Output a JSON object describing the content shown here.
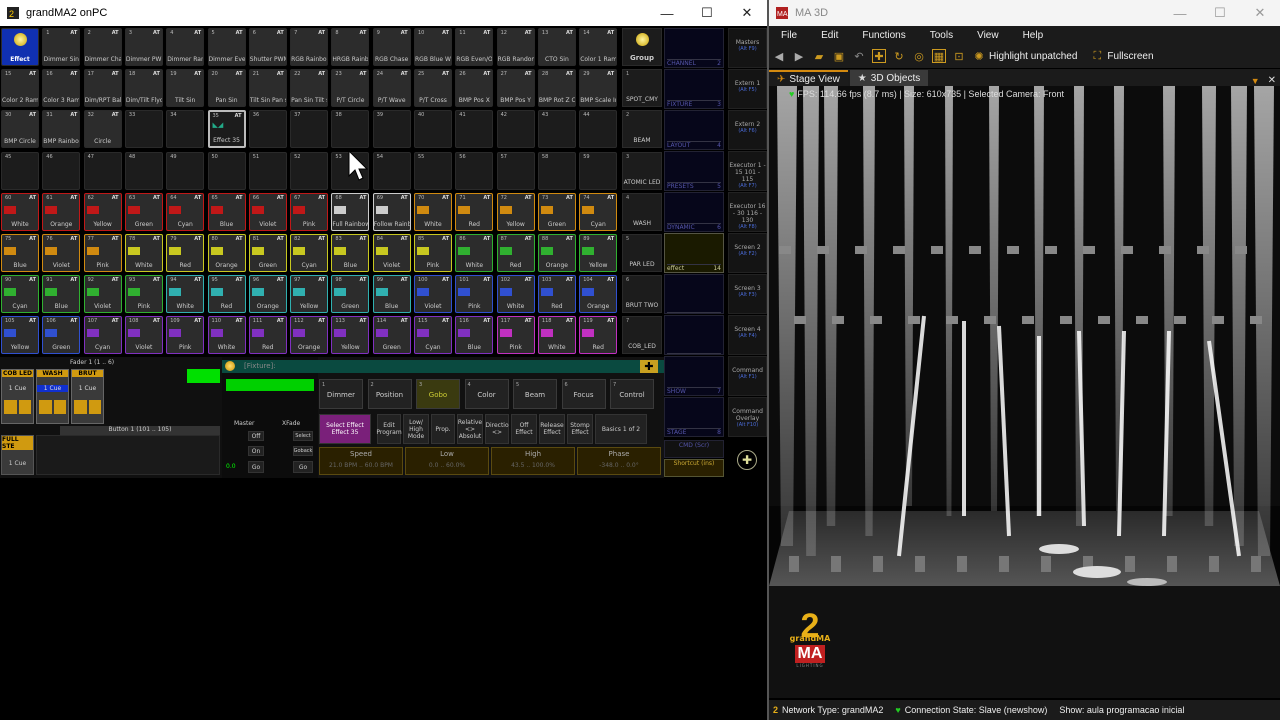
{
  "left_window": {
    "title": "grandMA2 onPC",
    "controls": {
      "minimize": "—",
      "maximize": "☐",
      "close": "✕"
    }
  },
  "grid_rows": [
    [
      {
        "n": "",
        "label": "Effect",
        "kind": "effect"
      },
      {
        "n": "1",
        "label": "Dimmer Sin"
      },
      {
        "n": "2",
        "label": "Dimmer Chase"
      },
      {
        "n": "3",
        "label": "Dimmer PWM"
      },
      {
        "n": "4",
        "label": "Dimmer Random"
      },
      {
        "n": "5",
        "label": "Dimmer Even/Odd"
      },
      {
        "n": "6",
        "label": "Shutter PWM"
      },
      {
        "n": "7",
        "label": "RGB Rainbow"
      },
      {
        "n": "8",
        "label": "HRGB Rainbow"
      },
      {
        "n": "9",
        "label": "RGB Chase"
      },
      {
        "n": "10",
        "label": "RGB Blue White"
      },
      {
        "n": "11",
        "label": "RGB Even/Odd"
      },
      {
        "n": "12",
        "label": "RGB Random"
      },
      {
        "n": "13",
        "label": "CTO Sin"
      },
      {
        "n": "14",
        "label": "Color 1 Ramp"
      }
    ],
    [
      {
        "n": "15",
        "label": "Color 2 Ramp"
      },
      {
        "n": "16",
        "label": "Color 3 Ramp"
      },
      {
        "n": "17",
        "label": "Dim/RPT Ballyhoo"
      },
      {
        "n": "18",
        "label": "Dim/Tilt Flyout"
      },
      {
        "n": "19",
        "label": "Tilt Sin"
      },
      {
        "n": "20",
        "label": "Pan Sin"
      },
      {
        "n": "21",
        "label": "Tilt Sin Pan stomp"
      },
      {
        "n": "22",
        "label": "Pan Sin Tilt stomp"
      },
      {
        "n": "23",
        "label": "P/T Circle"
      },
      {
        "n": "24",
        "label": "P/T Wave"
      },
      {
        "n": "25",
        "label": "P/T Cross"
      },
      {
        "n": "26",
        "label": "BMP Pos X"
      },
      {
        "n": "27",
        "label": "BMP Pos Y"
      },
      {
        "n": "28",
        "label": "BMP Rot Z CW"
      },
      {
        "n": "29",
        "label": "BMP Scale In"
      }
    ],
    [
      {
        "n": "30",
        "label": "BMP Circle"
      },
      {
        "n": "31",
        "label": "BMP Rainbow Hue"
      },
      {
        "n": "32",
        "label": "Circle"
      },
      {
        "n": "33",
        "label": ""
      },
      {
        "n": "34",
        "label": ""
      },
      {
        "n": "35",
        "label": "Effect 35",
        "kind": "sel"
      },
      {
        "n": "36",
        "label": ""
      },
      {
        "n": "37",
        "label": ""
      },
      {
        "n": "38",
        "label": ""
      },
      {
        "n": "39",
        "label": ""
      },
      {
        "n": "40",
        "label": ""
      },
      {
        "n": "41",
        "label": ""
      },
      {
        "n": "42",
        "label": ""
      },
      {
        "n": "43",
        "label": ""
      },
      {
        "n": "44",
        "label": ""
      }
    ],
    [
      {
        "n": "45",
        "label": ""
      },
      {
        "n": "46",
        "label": ""
      },
      {
        "n": "47",
        "label": ""
      },
      {
        "n": "48",
        "label": ""
      },
      {
        "n": "49",
        "label": ""
      },
      {
        "n": "50",
        "label": ""
      },
      {
        "n": "51",
        "label": ""
      },
      {
        "n": "52",
        "label": ""
      },
      {
        "n": "53",
        "label": ""
      },
      {
        "n": "54",
        "label": ""
      },
      {
        "n": "55",
        "label": ""
      },
      {
        "n": "56",
        "label": ""
      },
      {
        "n": "57",
        "label": ""
      },
      {
        "n": "58",
        "label": ""
      },
      {
        "n": "59",
        "label": ""
      }
    ],
    [
      {
        "n": "60",
        "label": "White",
        "c": "#c01818"
      },
      {
        "n": "61",
        "label": "Orange",
        "c": "#c01818"
      },
      {
        "n": "62",
        "label": "Yellow",
        "c": "#c01818"
      },
      {
        "n": "63",
        "label": "Green",
        "c": "#c01818"
      },
      {
        "n": "64",
        "label": "Cyan",
        "c": "#c01818"
      },
      {
        "n": "65",
        "label": "Blue",
        "c": "#c01818"
      },
      {
        "n": "66",
        "label": "Violet",
        "c": "#c01818"
      },
      {
        "n": "67",
        "label": "Pink",
        "c": "#c01818"
      },
      {
        "n": "68",
        "label": "Full Rainbow",
        "c": "#cccccc"
      },
      {
        "n": "69",
        "label": "Follow Rainbow",
        "c": "#cccccc"
      },
      {
        "n": "70",
        "label": "White",
        "c": "#d08a10"
      },
      {
        "n": "71",
        "label": "Red",
        "c": "#d08a10"
      },
      {
        "n": "72",
        "label": "Yellow",
        "c": "#d08a10"
      },
      {
        "n": "73",
        "label": "Green",
        "c": "#d08a10"
      },
      {
        "n": "74",
        "label": "Cyan",
        "c": "#d08a10"
      }
    ],
    [
      {
        "n": "75",
        "label": "Blue",
        "c": "#d08a10"
      },
      {
        "n": "76",
        "label": "Violet",
        "c": "#d08a10"
      },
      {
        "n": "77",
        "label": "Pink",
        "c": "#d08a10"
      },
      {
        "n": "78",
        "label": "White",
        "c": "#c8c820"
      },
      {
        "n": "79",
        "label": "Red",
        "c": "#c8c820"
      },
      {
        "n": "80",
        "label": "Orange",
        "c": "#c8c820"
      },
      {
        "n": "81",
        "label": "Green",
        "c": "#c8c820"
      },
      {
        "n": "82",
        "label": "Cyan",
        "c": "#c8c820"
      },
      {
        "n": "83",
        "label": "Blue",
        "c": "#c8c820"
      },
      {
        "n": "84",
        "label": "Violet",
        "c": "#c8c820"
      },
      {
        "n": "85",
        "label": "Pink",
        "c": "#c8c820"
      },
      {
        "n": "86",
        "label": "White",
        "c": "#30b030"
      },
      {
        "n": "87",
        "label": "Red",
        "c": "#30b030"
      },
      {
        "n": "88",
        "label": "Orange",
        "c": "#30b030"
      },
      {
        "n": "89",
        "label": "Yellow",
        "c": "#30b030"
      }
    ],
    [
      {
        "n": "90",
        "label": "Cyan",
        "c": "#30b030"
      },
      {
        "n": "91",
        "label": "Blue",
        "c": "#30b030"
      },
      {
        "n": "92",
        "label": "Violet",
        "c": "#30b030"
      },
      {
        "n": "93",
        "label": "Pink",
        "c": "#30b030"
      },
      {
        "n": "94",
        "label": "White",
        "c": "#30b0b0"
      },
      {
        "n": "95",
        "label": "Red",
        "c": "#30b0b0"
      },
      {
        "n": "96",
        "label": "Orange",
        "c": "#30b0b0"
      },
      {
        "n": "97",
        "label": "Yellow",
        "c": "#30b0b0"
      },
      {
        "n": "98",
        "label": "Green",
        "c": "#30b0b0"
      },
      {
        "n": "99",
        "label": "Blue",
        "c": "#30b0b0"
      },
      {
        "n": "100",
        "label": "Violet",
        "c": "#3050d0"
      },
      {
        "n": "101",
        "label": "Pink",
        "c": "#3050d0"
      },
      {
        "n": "102",
        "label": "White",
        "c": "#3050d0"
      },
      {
        "n": "103",
        "label": "Red",
        "c": "#3050d0"
      },
      {
        "n": "104",
        "label": "Orange",
        "c": "#3050d0"
      }
    ],
    [
      {
        "n": "105",
        "label": "Yellow",
        "c": "#3050d0"
      },
      {
        "n": "106",
        "label": "Green",
        "c": "#3050d0"
      },
      {
        "n": "107",
        "label": "Cyan",
        "c": "#8030c0"
      },
      {
        "n": "108",
        "label": "Violet",
        "c": "#8030c0"
      },
      {
        "n": "109",
        "label": "Pink",
        "c": "#8030c0"
      },
      {
        "n": "110",
        "label": "White",
        "c": "#8030c0"
      },
      {
        "n": "111",
        "label": "Red",
        "c": "#8030c0"
      },
      {
        "n": "112",
        "label": "Orange",
        "c": "#8030c0"
      },
      {
        "n": "113",
        "label": "Yellow",
        "c": "#8030c0"
      },
      {
        "n": "114",
        "label": "Green",
        "c": "#8030c0"
      },
      {
        "n": "115",
        "label": "Cyan",
        "c": "#8030c0"
      },
      {
        "n": "116",
        "label": "Blue",
        "c": "#8030c0"
      },
      {
        "n": "117",
        "label": "Pink",
        "c": "#c030c0"
      },
      {
        "n": "118",
        "label": "White",
        "c": "#c030c0"
      },
      {
        "n": "119",
        "label": "Red",
        "c": "#c030c0"
      }
    ]
  ],
  "group_column": [
    {
      "n": "",
      "label": "Group"
    },
    {
      "n": "1",
      "label": "SPOT_CMY"
    },
    {
      "n": "2",
      "label": "BEAM"
    },
    {
      "n": "3",
      "label": "ATOMIC LED"
    },
    {
      "n": "4",
      "label": "WASH"
    },
    {
      "n": "5",
      "label": "PAR LED"
    },
    {
      "n": "6",
      "label": "BRUT TWO"
    },
    {
      "n": "7",
      "label": "COB_LED"
    }
  ],
  "mini_panels": [
    {
      "name": "CHANNEL",
      "n": "2"
    },
    {
      "name": "FIXTURE",
      "n": "3"
    },
    {
      "name": "LAYOUT",
      "n": "4"
    },
    {
      "name": "PRESETS",
      "n": "5"
    },
    {
      "name": "DYNAMIC",
      "n": "6"
    },
    {
      "name": "effect",
      "n": "14"
    },
    {
      "name": "",
      "n": ""
    },
    {
      "name": "",
      "n": ""
    },
    {
      "name": "SHOW",
      "n": "7"
    },
    {
      "name": "STAGE",
      "n": "8"
    }
  ],
  "mini_cmd": "CMD (Scr)",
  "mini_shortcut": "Shortcut (ins)",
  "views": [
    {
      "label": "Masters",
      "key": "(Alt F9)"
    },
    {
      "label": "Extern 1",
      "key": "(Alt F5)"
    },
    {
      "label": "Extern 2",
      "key": "(Alt F6)"
    },
    {
      "label": "Executor 1 - 15 101 - 115",
      "key": "(Alt F7)"
    },
    {
      "label": "Executor 16 - 30 116 - 130",
      "key": "(Alt F8)"
    },
    {
      "label": "Screen 2",
      "key": "(Alt F2)"
    },
    {
      "label": "Screen 3",
      "key": "(Alt F3)"
    },
    {
      "label": "Screen 4",
      "key": "(Alt F4)"
    },
    {
      "label": "Command",
      "key": "(Alt F1)"
    },
    {
      "label": "Command Overlay",
      "key": "(Alt F10)"
    }
  ],
  "fader": {
    "header": "Fader 1 (1 .. 6)",
    "execs": [
      {
        "label": "COB LED",
        "cue": "1 Cue"
      },
      {
        "label": "WASH",
        "cue": "1 Cue"
      },
      {
        "label": "BRUT",
        "cue": "1 Cue"
      }
    ],
    "button_header": "Button 1 (101 .. 105)",
    "full_label": "FULL STE",
    "full_cue": "1 Cue",
    "master": "Master",
    "xfade": "XFade",
    "off": "Off",
    "on": "On",
    "go": "Go",
    "select": "Select",
    "goback": "Goback",
    "val": "0.0"
  },
  "dialog": {
    "title": "[Fixture]:",
    "features": [
      "Dimmer",
      "Position",
      "Gobo",
      "Color",
      "Beam",
      "Focus",
      "Control"
    ],
    "feature_nums": [
      "1",
      "2",
      "3",
      "4",
      "5",
      "6",
      "7"
    ],
    "active_feature": 2,
    "subbtns": [
      "Select Effect Effect 35",
      "Edit Program",
      "Low/ High Mode",
      "Prop.",
      "Relative <> Absolut",
      "Directio <>",
      "Off Effect",
      "Release Effect",
      "Stomp Effect",
      "Basics 1 of 2"
    ],
    "encoders": [
      {
        "name": "Speed",
        "val": "21.0 BPM .. 60.0 BPM"
      },
      {
        "name": "Low",
        "val": "0.0 .. 60.0%"
      },
      {
        "name": "High",
        "val": "43.5 .. 100.0%"
      },
      {
        "name": "Phase",
        "val": "-348.0 .. 0.0°"
      }
    ]
  },
  "right_window": {
    "title": "MA 3D",
    "controls": {
      "minimize": "—",
      "maximize": "☐",
      "close": "✕"
    },
    "menu": [
      "File",
      "Edit",
      "Functions",
      "Tools",
      "View",
      "Help"
    ],
    "toolbar_highlight": "Highlight unpatched",
    "toolbar_fullscreen": "Fullscreen",
    "tabs": [
      "Stage View",
      "3D Objects"
    ],
    "fps": "FPS: 114.66 fps (8.7 ms) | Size: 610x735 | Selected Camera: Front",
    "logo_top": "grandMA",
    "logo_letters": "MA",
    "logo_sub": "LIGHTING",
    "status": {
      "network": "Network Type: grandMA2",
      "connection": "Connection State: Slave (newshow)",
      "show": "Show: aula programacao inicial"
    }
  },
  "colors": {
    "effect_blue": "#1030b0",
    "accent": "#d08a10",
    "dialog_bg": "#0a4a40",
    "connection_icon": "#22cc22"
  }
}
